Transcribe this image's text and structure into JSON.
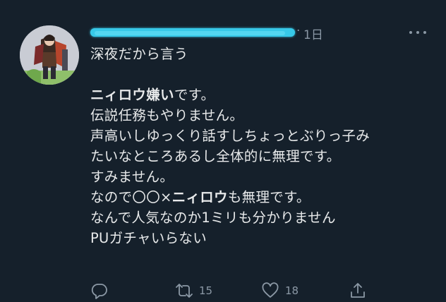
{
  "tweet": {
    "author_name": "",
    "separator": "·",
    "time": "1日",
    "lines": [
      {
        "parts": [
          {
            "text": "深夜だから言う",
            "bold": false
          }
        ]
      },
      {
        "parts": [
          {
            "text": "",
            "bold": false
          }
        ]
      },
      {
        "parts": [
          {
            "text": "ニィロウ嫌い",
            "bold": true
          },
          {
            "text": "です。",
            "bold": false
          }
        ]
      },
      {
        "parts": [
          {
            "text": "伝説任務もやりません。",
            "bold": false
          }
        ]
      },
      {
        "parts": [
          {
            "text": "声高いしゆっくり話すしちょっとぶりっ子み",
            "bold": false
          }
        ]
      },
      {
        "parts": [
          {
            "text": "たいなところあるし全体的に無理です。",
            "bold": false
          }
        ]
      },
      {
        "parts": [
          {
            "text": "すみません。",
            "bold": false
          }
        ]
      },
      {
        "parts": [
          {
            "text": "なので〇〇×",
            "bold": false
          },
          {
            "text": "ニィロウ",
            "bold": true
          },
          {
            "text": "も無理です。",
            "bold": false
          }
        ]
      },
      {
        "parts": [
          {
            "text": "なんで人気なのか1ミリも分かりません",
            "bold": false
          }
        ]
      },
      {
        "parts": [
          {
            "text": "PUガチャいらない",
            "bold": false
          }
        ]
      }
    ]
  },
  "actions": {
    "reply_count": "",
    "retweet_count": "15",
    "like_count": "18"
  },
  "icons": {
    "reply": "speech-bubble-icon",
    "retweet": "retweet-arrows-icon",
    "like": "heart-icon",
    "share": "share-upload-icon",
    "more": "more-horizontal-icon"
  },
  "colors": {
    "background": "#15202b",
    "text": "#e7e9ea",
    "muted": "#8b98a5",
    "redaction": "#37c9e8"
  }
}
